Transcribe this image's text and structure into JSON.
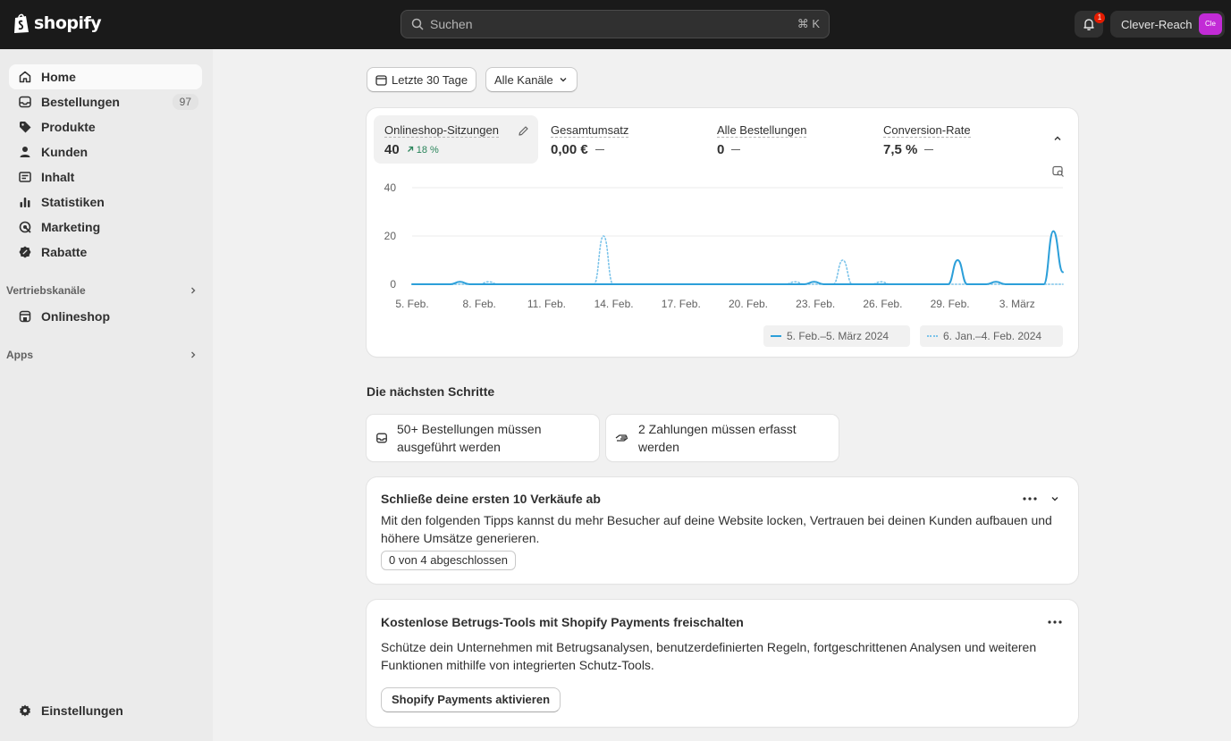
{
  "topbar": {
    "brand": "shopify",
    "search_placeholder": "Suchen",
    "search_shortcut": "⌘ K",
    "notification_count": "1",
    "store_name": "Clever-Reach",
    "store_avatar": "Cle"
  },
  "sidebar": {
    "items": [
      {
        "label": "Home",
        "icon": "home-icon"
      },
      {
        "label": "Bestellungen",
        "icon": "inbox-icon",
        "count": "97"
      },
      {
        "label": "Produkte",
        "icon": "tag-icon"
      },
      {
        "label": "Kunden",
        "icon": "person-icon"
      },
      {
        "label": "Inhalt",
        "icon": "image-icon"
      },
      {
        "label": "Statistiken",
        "icon": "bar-chart-icon"
      },
      {
        "label": "Marketing",
        "icon": "target-icon"
      },
      {
        "label": "Rabatte",
        "icon": "discount-icon"
      }
    ],
    "sales_channels_label": "Vertriebskanäle",
    "online_store_label": "Onlineshop",
    "apps_label": "Apps",
    "settings_label": "Einstellungen"
  },
  "filters": {
    "date_range": "Letzte 30 Tage",
    "channels": "Alle Kanäle"
  },
  "metrics": [
    {
      "label": "Onlineshop-Sitzungen",
      "value": "40",
      "change": "18 %"
    },
    {
      "label": "Gesamtumsatz",
      "value": "0,00 €"
    },
    {
      "label": "Alle Bestellungen",
      "value": "0"
    },
    {
      "label": "Conversion-Rate",
      "value": "7,5 %"
    }
  ],
  "chart_data": {
    "type": "line",
    "x": [
      "5. Feb.",
      "8. Feb.",
      "11. Feb.",
      "14. Feb.",
      "17. Feb.",
      "20. Feb.",
      "23. Feb.",
      "26. Feb.",
      "29. Feb.",
      "3. März"
    ],
    "ylim": [
      0,
      40
    ],
    "yticks": [
      "40",
      "20",
      "0"
    ],
    "series": [
      {
        "name": "5. Feb.–5. März 2024",
        "color": "#2c9fd9",
        "style": "solid",
        "values": [
          0,
          0,
          0,
          0,
          0,
          1,
          0,
          0,
          0,
          0,
          0,
          0,
          0,
          0,
          0,
          0,
          0,
          0,
          0,
          0,
          0,
          0,
          0,
          0,
          0,
          0,
          0,
          0,
          0,
          0,
          0,
          0,
          0,
          0,
          0,
          0,
          0,
          0,
          0,
          0,
          0,
          0,
          1,
          0,
          0,
          0,
          0,
          0,
          0,
          0,
          0,
          0,
          0,
          0,
          0,
          0,
          0,
          10,
          0,
          0,
          0,
          1,
          0,
          0,
          0,
          0,
          0,
          22,
          5
        ]
      },
      {
        "name": "6. Jan.–4. Feb. 2024",
        "color": "#7cc4ea",
        "style": "dotted",
        "values": [
          0,
          0,
          0,
          0,
          0,
          0,
          0,
          0,
          1,
          0,
          0,
          0,
          0,
          0,
          0,
          0,
          0,
          0,
          0,
          0,
          20,
          0,
          0,
          0,
          0,
          0,
          0,
          0,
          0,
          0,
          0,
          0,
          0,
          0,
          0,
          0,
          0,
          0,
          0,
          0,
          1,
          0,
          0,
          0,
          0,
          10,
          0,
          0,
          0,
          1,
          0,
          0,
          0,
          0,
          0,
          0,
          0,
          0,
          0,
          0,
          0,
          0,
          0,
          0,
          0,
          0,
          0,
          0,
          0
        ]
      }
    ],
    "legend": "bottom-right"
  },
  "next_steps": {
    "title": "Die nächsten Schritte",
    "items": [
      {
        "label": "50+ Bestellungen müssen ausgeführt werden",
        "icon": "inbox-icon"
      },
      {
        "label": "2 Zahlungen müssen erfasst werden",
        "icon": "money-icon"
      }
    ]
  },
  "sales_card": {
    "title": "Schließe deine ersten 10 Verkäufe ab",
    "text": "Mit den folgenden Tipps kannst du mehr Besucher auf deine Website locken, Vertrauen bei deinen Kunden aufbauen und höhere Umsätze generieren.",
    "progress": "0 von 4 abgeschlossen"
  },
  "fraud_card": {
    "title": "Kostenlose Betrugs-Tools mit Shopify Payments freischalten",
    "text": "Schütze dein Unternehmen mit Betrugsanalysen, benutzerdefinierten Regeln, fortgeschrittenen Analysen und weiteren Funktionen mithilfe von integrierten Schutz-Tools.",
    "button": "Shopify Payments aktivieren"
  }
}
